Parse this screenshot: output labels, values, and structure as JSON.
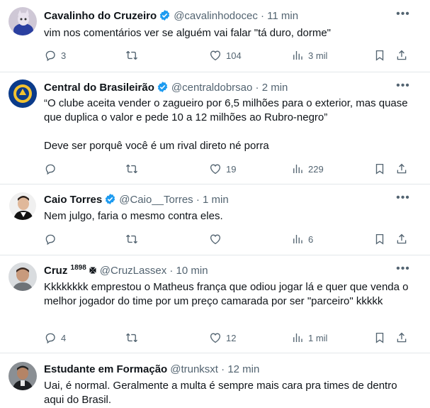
{
  "tweets": [
    {
      "name": "Cavalinho do Cruzeiro",
      "verified": true,
      "handle": "@cavalinhodocec",
      "time": "11 min",
      "text": "vim nos comentários ver se alguém vai falar \"tá duro, dorme\"",
      "replies": "3",
      "retweets": "",
      "likes": "104",
      "views": "3 mil"
    },
    {
      "name": "Central do Brasileirão",
      "verified": true,
      "handle": "@centraldobrsao",
      "time": "2 min",
      "text": "“O clube aceita vender o zagueiro por 6,5 milhões para o exterior, mas quase que duplica o valor e pede 10 a 12 milhões ao Rubro-negro”\n\nDeve ser porquê você é um rival direto né porra",
      "replies": "",
      "retweets": "",
      "likes": "19",
      "views": "229"
    },
    {
      "name": "Caio Torres",
      "verified": true,
      "handle": "@Caio__Torres",
      "time": "1 min",
      "text": "Nem julgo, faria o mesmo contra eles.",
      "replies": "",
      "retweets": "",
      "likes": "",
      "views": "6"
    },
    {
      "name": "Cruz",
      "name_sup": "1898",
      "verified": false,
      "handle": "@CruzLassex",
      "time": "10 min",
      "text": "Kkkkkkkk emprestou o Matheus frança que odiou jogar lá e quer que venda o melhor jogador do time por um preço camarada por ser \"parceiro\" kkkkk",
      "replies": "4",
      "retweets": "",
      "likes": "12",
      "views": "1 mil"
    },
    {
      "name": "Estudante em Formação",
      "verified": false,
      "handle": "@trunksxt",
      "time": "12 min",
      "text": "Uai, é normal. Geralmente a multa é sempre mais cara pra times de dentro aqui do Brasil."
    }
  ],
  "separator": "·",
  "icons": {
    "reply": "reply-icon",
    "retweet": "retweet-icon",
    "like": "heart-icon",
    "views": "views-icon",
    "bookmark": "bookmark-icon",
    "share": "share-icon",
    "more": "more-icon",
    "verified": "verified-badge-icon"
  },
  "colors": {
    "text": "#0f1419",
    "secondary": "#536471",
    "verified": "#1d9bf0",
    "divider": "#e3e7ea"
  }
}
